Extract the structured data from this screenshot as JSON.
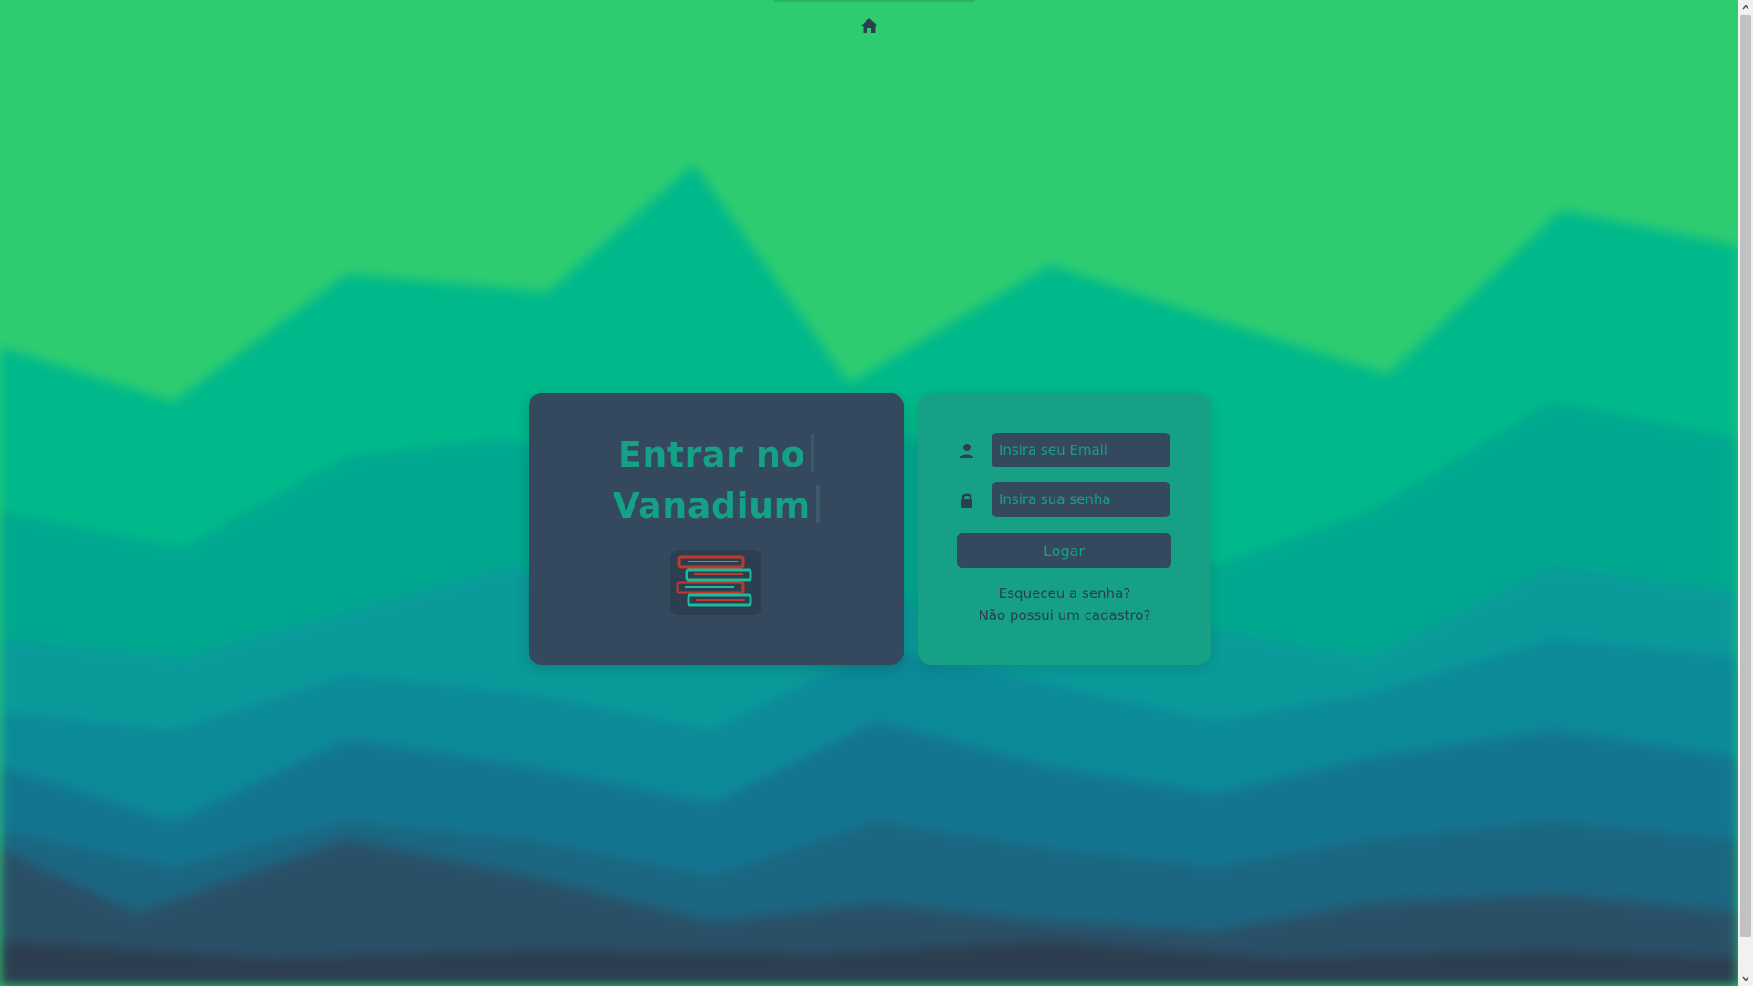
{
  "colors": {
    "bg_top": "#2ecc71",
    "dark_card": "#34495e",
    "teal_card": "#16a085",
    "accent_text": "#16a085",
    "link_text": "#2c3e50"
  },
  "nav": {
    "home_icon": "home-icon"
  },
  "intro": {
    "title_line1": "Entrar no",
    "title_line2": "Vanadium",
    "logo_icon": "stacked-books-icon"
  },
  "login": {
    "email_icon": "user-icon",
    "email_placeholder": "Insira seu Email",
    "email_value": "",
    "password_icon": "lock-icon",
    "password_placeholder": "Insira sua senha",
    "password_value": "",
    "submit_label": "Logar",
    "forgot_password": "Esqueceu a senha?",
    "register": "Não possui um cadastro?"
  }
}
